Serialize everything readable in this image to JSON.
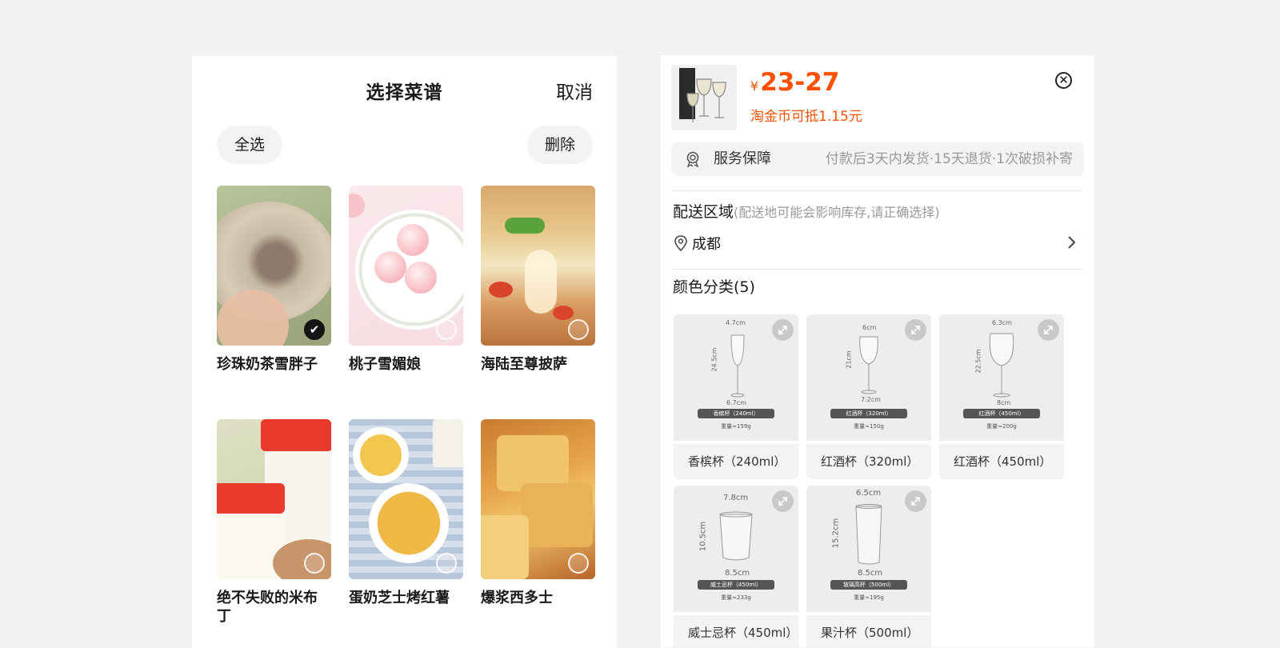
{
  "recipes_panel": {
    "title": "选择菜谱",
    "cancel_label": "取消",
    "select_all_label": "全选",
    "delete_label": "删除",
    "items": [
      {
        "name": "珍珠奶茶雪胖子",
        "selected": true
      },
      {
        "name": "桃子雪媚娘",
        "selected": false
      },
      {
        "name": "海陆至尊披萨",
        "selected": false
      },
      {
        "name": "绝不失败的米布丁",
        "selected": false
      },
      {
        "name": "蛋奶芝士烤红薯",
        "selected": false
      },
      {
        "name": "爆浆西多士",
        "selected": false
      }
    ],
    "check_glyph": "✔"
  },
  "product_panel": {
    "currency": "¥",
    "price_range": "23-27",
    "coin_discount": "淘金币可抵1.15元",
    "close_glyph": "✕",
    "service": {
      "label": "服务保障",
      "desc": "付款后3天内发货·15天退货·1次破损补寄",
      "icon": "badge-icon"
    },
    "delivery": {
      "title": "配送区域",
      "hint": "(配送地可能会影响库存,请正确选择)",
      "city": "成都"
    },
    "color_category_title": "颜色分类(5)",
    "variants": [
      {
        "label": "香槟杯（240ml）",
        "top_dim": "4.7cm",
        "side_dim": "24.5cm",
        "base_dim": "6.7cm",
        "tag": "香槟杯（240ml）",
        "weight": "重量≈159g"
      },
      {
        "label": "红酒杯（320ml）",
        "top_dim": "6cm",
        "side_dim": "21cm",
        "base_dim": "7.2cm",
        "tag": "红酒杯（320ml）",
        "weight": "重量≈150g"
      },
      {
        "label": "红酒杯（450ml）",
        "top_dim": "6.3cm",
        "side_dim": "22.5cm",
        "base_dim": "8cm",
        "tag": "红酒杯（450ml）",
        "weight": "重量≈200g"
      },
      {
        "label": "威士忌杯（450ml）",
        "top_dim": "7.8cm",
        "side_dim": "10.5cm",
        "base_dim": "8.5cm",
        "tag": "威士忌杯（450ml）",
        "weight": "重量≈233g"
      },
      {
        "label": "果汁杯（500ml）",
        "top_dim": "6.5cm",
        "side_dim": "15.2cm",
        "base_dim": "8.5cm",
        "tag": "玻璃高杯（500ml）",
        "weight": "重量≈195g"
      }
    ]
  },
  "colors": {
    "accent": "#ff5000",
    "page_bg": "#f2f2f2",
    "panel_bg": "#ffffff",
    "chip_bg": "#f3f3f3"
  }
}
